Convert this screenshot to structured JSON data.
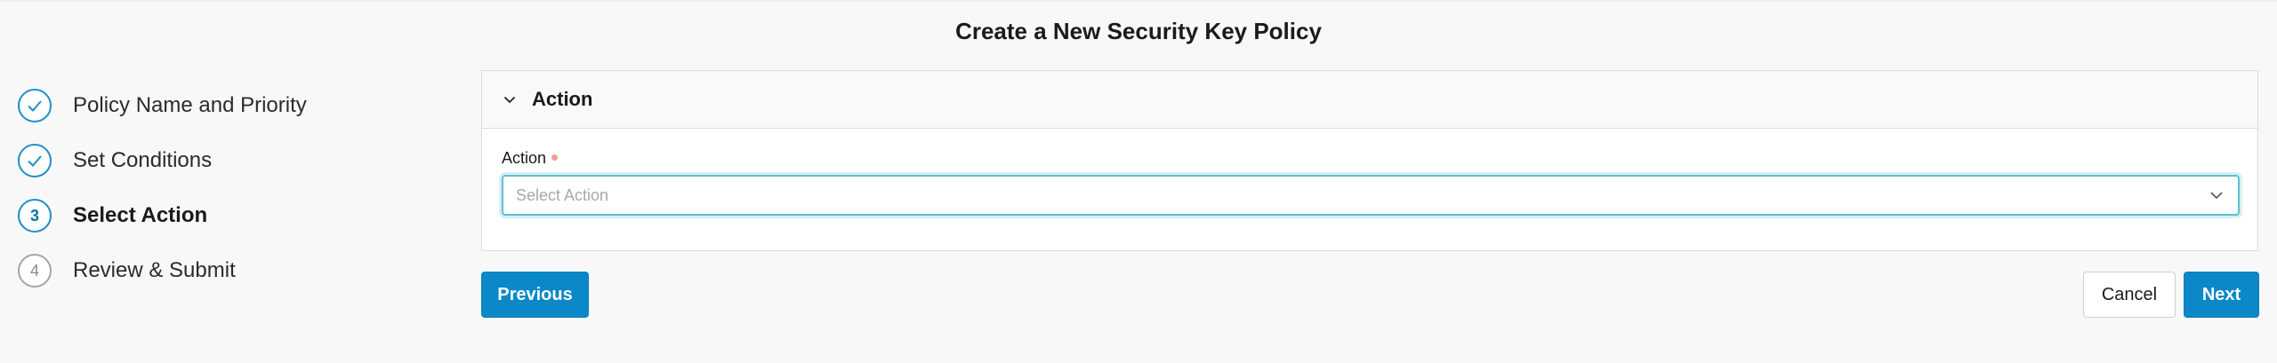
{
  "page": {
    "title": "Create a New Security Key Policy"
  },
  "stepper": {
    "steps": [
      {
        "label": "Policy Name and Priority",
        "state": "completed",
        "marker": ""
      },
      {
        "label": "Set Conditions",
        "state": "completed",
        "marker": ""
      },
      {
        "label": "Select Action",
        "state": "current",
        "marker": "3"
      },
      {
        "label": "Review & Submit",
        "state": "pending",
        "marker": "4"
      }
    ]
  },
  "panel": {
    "title": "Action",
    "field_label": "Action",
    "select_placeholder": "Select Action"
  },
  "buttons": {
    "previous": "Previous",
    "cancel": "Cancel",
    "next": "Next"
  },
  "colors": {
    "accent": "#0a88c7",
    "step_border": "#1f8fc7",
    "focus_ring": "#5fc0cf",
    "required": "#f29a9a"
  }
}
